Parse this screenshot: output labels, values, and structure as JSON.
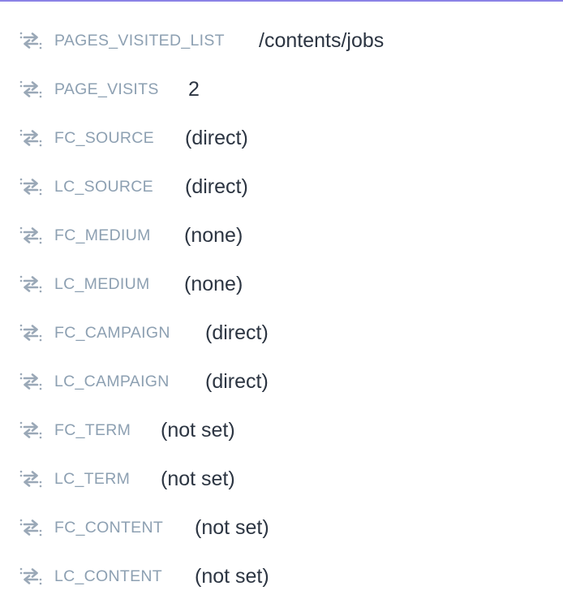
{
  "properties": [
    {
      "key": "PAGES_VISITED_LIST",
      "value": "/contents/jobs",
      "icon": "swap-arrows-icon"
    },
    {
      "key": "PAGE_VISITS",
      "value": "2",
      "icon": "swap-arrows-icon"
    },
    {
      "key": "FC_SOURCE",
      "value": "(direct)",
      "icon": "swap-arrows-icon"
    },
    {
      "key": "LC_SOURCE",
      "value": "(direct)",
      "icon": "swap-arrows-icon"
    },
    {
      "key": "FC_MEDIUM",
      "value": "(none)",
      "icon": "swap-arrows-icon"
    },
    {
      "key": "LC_MEDIUM",
      "value": "(none)",
      "icon": "swap-arrows-icon"
    },
    {
      "key": "FC_CAMPAIGN",
      "value": "(direct)",
      "icon": "swap-arrows-icon"
    },
    {
      "key": "LC_CAMPAIGN",
      "value": "(direct)",
      "icon": "swap-arrows-icon"
    },
    {
      "key": "FC_TERM",
      "value": "(not set)",
      "icon": "swap-arrows-icon"
    },
    {
      "key": "LC_TERM",
      "value": "(not set)",
      "icon": "swap-arrows-icon"
    },
    {
      "key": "FC_CONTENT",
      "value": "(not set)",
      "icon": "swap-arrows-icon"
    },
    {
      "key": "LC_CONTENT",
      "value": "(not set)",
      "icon": "swap-arrows-icon"
    }
  ],
  "colors": {
    "accent_border": "#8b82e6",
    "key_text": "#8da0b2",
    "value_text": "#2c3542",
    "icon": "#9aa8b7"
  }
}
